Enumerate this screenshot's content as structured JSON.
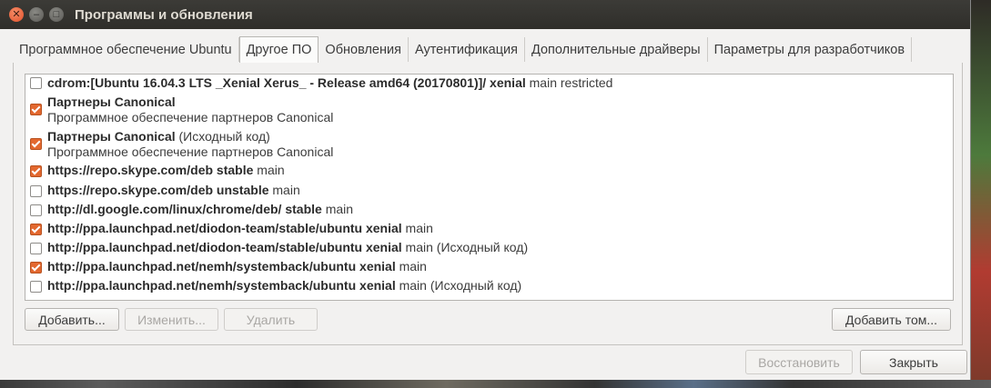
{
  "window": {
    "title": "Программы и обновления"
  },
  "tabs": [
    {
      "label": "Программное обеспечение Ubuntu"
    },
    {
      "label": "Другое ПО"
    },
    {
      "label": "Обновления"
    },
    {
      "label": "Аутентификация"
    },
    {
      "label": "Дополнительные драйверы"
    },
    {
      "label": "Параметры для разработчиков"
    }
  ],
  "active_tab": "Другое ПО",
  "sources": [
    {
      "checked": false,
      "bold": "cdrom:[Ubuntu 16.04.3 LTS _Xenial Xerus_ - Release amd64 (20170801)]/ xenial",
      "rest": " main restricted",
      "sub": ""
    },
    {
      "checked": true,
      "bold": "Партнеры Canonical",
      "rest": "",
      "sub": "Программное обеспечение партнеров Canonical"
    },
    {
      "checked": true,
      "bold": "Партнеры Canonical",
      "rest": " (Исходный код)",
      "sub": "Программное обеспечение партнеров Canonical"
    },
    {
      "checked": true,
      "bold": "https://repo.skype.com/deb stable",
      "rest": " main",
      "sub": ""
    },
    {
      "checked": false,
      "bold": "https://repo.skype.com/deb unstable",
      "rest": " main",
      "sub": ""
    },
    {
      "checked": false,
      "bold": "http://dl.google.com/linux/chrome/deb/ stable",
      "rest": " main",
      "sub": ""
    },
    {
      "checked": true,
      "bold": "http://ppa.launchpad.net/diodon-team/stable/ubuntu xenial",
      "rest": " main",
      "sub": ""
    },
    {
      "checked": false,
      "bold": "http://ppa.launchpad.net/diodon-team/stable/ubuntu xenial",
      "rest": " main (Исходный код)",
      "sub": ""
    },
    {
      "checked": true,
      "bold": "http://ppa.launchpad.net/nemh/systemback/ubuntu xenial",
      "rest": " main",
      "sub": ""
    },
    {
      "checked": false,
      "bold": "http://ppa.launchpad.net/nemh/systemback/ubuntu xenial",
      "rest": " main (Исходный код)",
      "sub": ""
    }
  ],
  "buttons": {
    "add": "Добавить...",
    "edit": "Изменить...",
    "remove": "Удалить",
    "add_volume": "Добавить том...",
    "revert": "Восстановить",
    "close": "Закрыть"
  },
  "colors": {
    "accent": "#e3682f",
    "titlebar": "#3c3b37"
  }
}
